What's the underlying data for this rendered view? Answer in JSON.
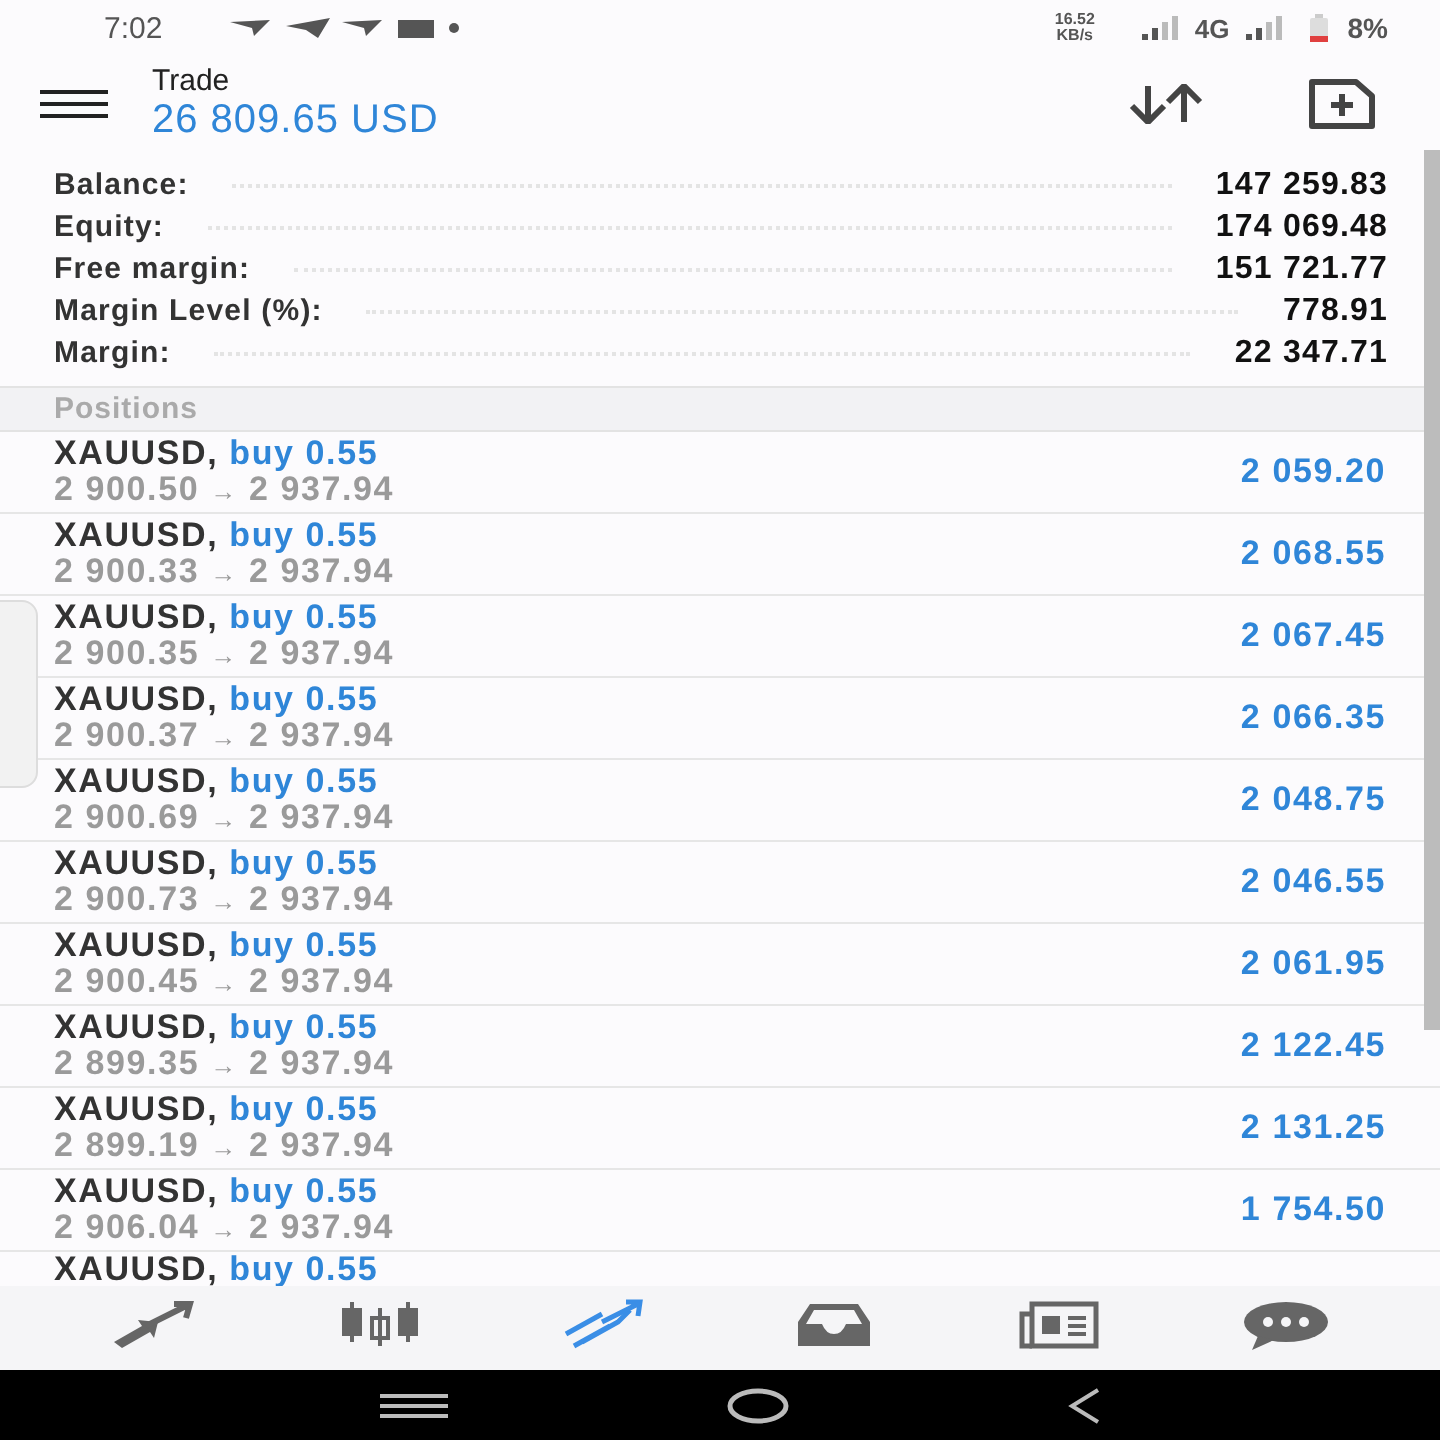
{
  "status_bar": {
    "time": "7:02",
    "speed_value": "16.52",
    "speed_unit": "KB/s",
    "network": "4G",
    "battery": "8%"
  },
  "header": {
    "title": "Trade",
    "balance": "26 809.65 USD"
  },
  "summary": [
    {
      "label": "Balance:",
      "value": "147 259.83"
    },
    {
      "label": "Equity:",
      "value": "174 069.48"
    },
    {
      "label": "Free margin:",
      "value": "151 721.77"
    },
    {
      "label": "Margin Level (%):",
      "value": "778.91"
    },
    {
      "label": "Margin:",
      "value": "22 347.71"
    }
  ],
  "positions": {
    "title": "Positions",
    "rows": [
      {
        "symbol": "XAUUSD,",
        "order": "buy 0.55",
        "open_price": "2 900.50",
        "arrow": "→",
        "current_price": "2 937.94",
        "profit": "2 059.20"
      },
      {
        "symbol": "XAUUSD,",
        "order": "buy 0.55",
        "open_price": "2 900.33",
        "arrow": "→",
        "current_price": "2 937.94",
        "profit": "2 068.55"
      },
      {
        "symbol": "XAUUSD,",
        "order": "buy 0.55",
        "open_price": "2 900.35",
        "arrow": "→",
        "current_price": "2 937.94",
        "profit": "2 067.45"
      },
      {
        "symbol": "XAUUSD,",
        "order": "buy 0.55",
        "open_price": "2 900.37",
        "arrow": "→",
        "current_price": "2 937.94",
        "profit": "2 066.35"
      },
      {
        "symbol": "XAUUSD,",
        "order": "buy 0.55",
        "open_price": "2 900.69",
        "arrow": "→",
        "current_price": "2 937.94",
        "profit": "2 048.75"
      },
      {
        "symbol": "XAUUSD,",
        "order": "buy 0.55",
        "open_price": "2 900.73",
        "arrow": "→",
        "current_price": "2 937.94",
        "profit": "2 046.55"
      },
      {
        "symbol": "XAUUSD,",
        "order": "buy 0.55",
        "open_price": "2 900.45",
        "arrow": "→",
        "current_price": "2 937.94",
        "profit": "2 061.95"
      },
      {
        "symbol": "XAUUSD,",
        "order": "buy 0.55",
        "open_price": "2 899.35",
        "arrow": "→",
        "current_price": "2 937.94",
        "profit": "2 122.45"
      },
      {
        "symbol": "XAUUSD,",
        "order": "buy 0.55",
        "open_price": "2 899.19",
        "arrow": "→",
        "current_price": "2 937.94",
        "profit": "2 131.25"
      },
      {
        "symbol": "XAUUSD,",
        "order": "buy 0.55",
        "open_price": "2 906.04",
        "arrow": "→",
        "current_price": "2 937.94",
        "profit": "1 754.50"
      },
      {
        "symbol": "XAUUSD,",
        "order": "buy 0.55"
      }
    ]
  },
  "bottom_tabs": [
    {
      "kind": "quotes",
      "selected": false
    },
    {
      "kind": "chart",
      "selected": false
    },
    {
      "kind": "trade",
      "selected": true
    },
    {
      "kind": "history",
      "selected": false
    },
    {
      "kind": "news",
      "selected": false
    },
    {
      "kind": "messages",
      "selected": false
    }
  ]
}
